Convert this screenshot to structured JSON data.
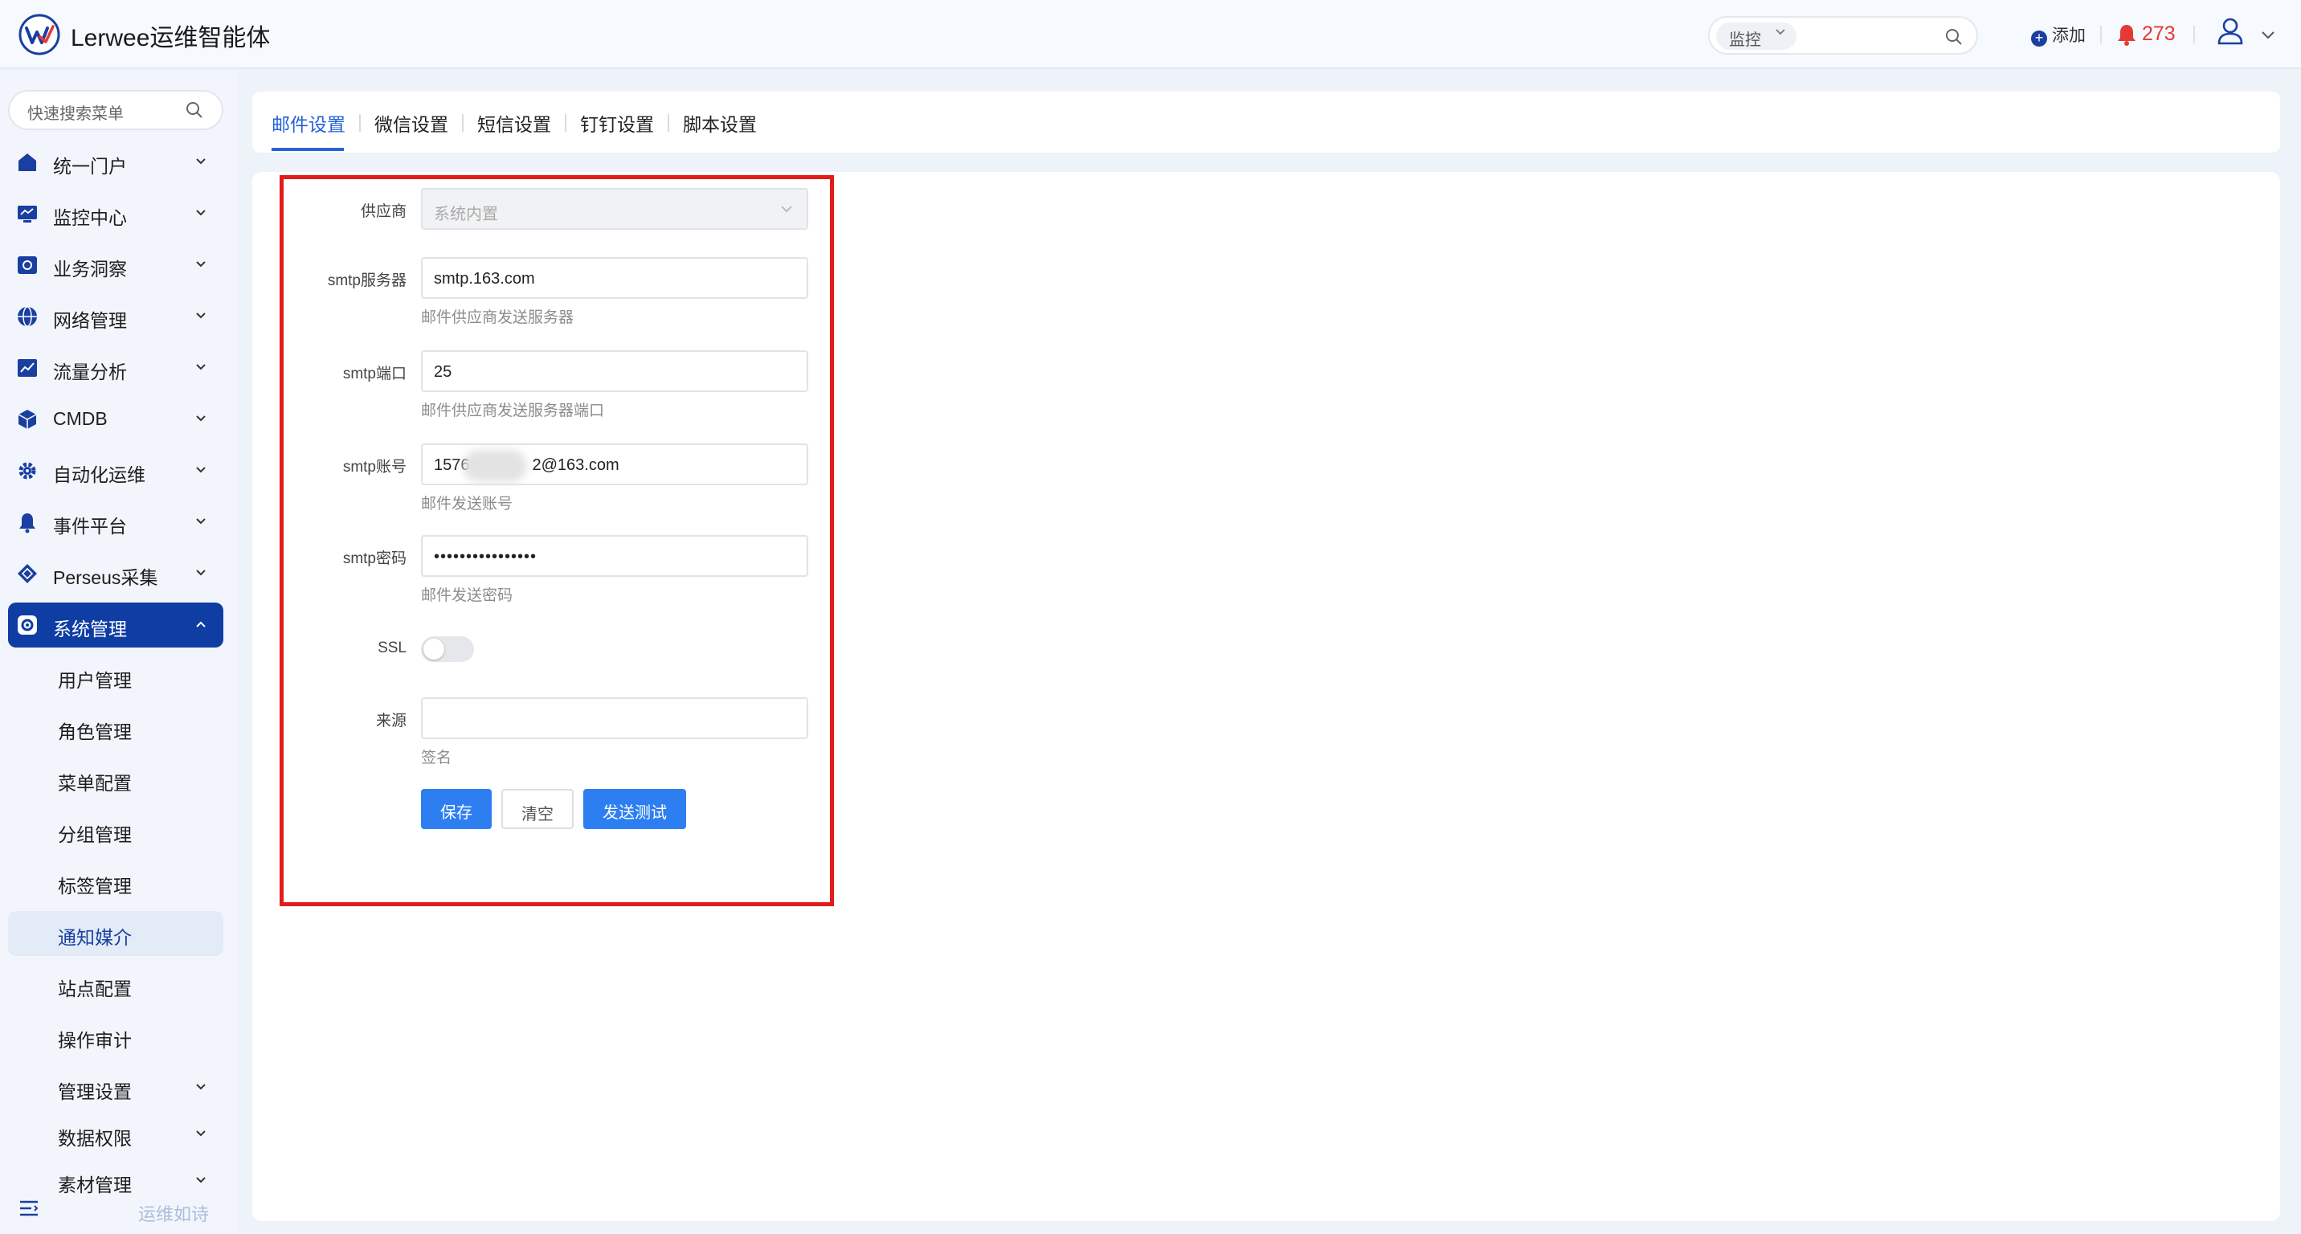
{
  "app": {
    "title": "Lerwee运维智能体"
  },
  "topbar": {
    "search_scope": "监控",
    "add_label": "添加",
    "alert_count": "273"
  },
  "sidebar": {
    "search_placeholder": "快速搜索菜单",
    "items": [
      {
        "label": "统一门户",
        "icon": "home-icon"
      },
      {
        "label": "监控中心",
        "icon": "monitor-icon"
      },
      {
        "label": "业务洞察",
        "icon": "insight-icon"
      },
      {
        "label": "网络管理",
        "icon": "globe-icon"
      },
      {
        "label": "流量分析",
        "icon": "chart-icon"
      },
      {
        "label": "CMDB",
        "icon": "cube-icon"
      },
      {
        "label": "自动化运维",
        "icon": "gear-icon"
      },
      {
        "label": "事件平台",
        "icon": "bell-icon"
      },
      {
        "label": "Perseus采集",
        "icon": "diamond-icon"
      },
      {
        "label": "系统管理",
        "icon": "settings-icon",
        "expanded": true
      }
    ],
    "sub_items": [
      {
        "label": "用户管理"
      },
      {
        "label": "角色管理"
      },
      {
        "label": "菜单配置"
      },
      {
        "label": "分组管理"
      },
      {
        "label": "标签管理"
      },
      {
        "label": "通知媒介",
        "current": true
      },
      {
        "label": "站点配置"
      },
      {
        "label": "操作审计"
      },
      {
        "label": "管理设置",
        "expandable": true
      },
      {
        "label": "数据权限",
        "expandable": true
      },
      {
        "label": "素材管理",
        "expandable": true
      }
    ],
    "footer_text": "运维如诗"
  },
  "tabs": [
    {
      "label": "邮件设置",
      "active": true
    },
    {
      "label": "微信设置"
    },
    {
      "label": "短信设置"
    },
    {
      "label": "钉钉设置"
    },
    {
      "label": "脚本设置"
    }
  ],
  "form": {
    "provider": {
      "label": "供应商",
      "value": "系统内置"
    },
    "smtp_server": {
      "label": "smtp服务器",
      "value": "smtp.163.com",
      "hint": "邮件供应商发送服务器"
    },
    "smtp_port": {
      "label": "smtp端口",
      "value": "25",
      "hint": "邮件供应商发送服务器端口"
    },
    "smtp_account": {
      "label": "smtp账号",
      "value_prefix": "1576",
      "value_suffix": "2@163.com",
      "hint": "邮件发送账号"
    },
    "smtp_password": {
      "label": "smtp密码",
      "value": "••••••••••••••••",
      "hint": "邮件发送密码"
    },
    "ssl": {
      "label": "SSL",
      "enabled": false
    },
    "source": {
      "label": "来源",
      "value": "",
      "hint": "签名"
    },
    "buttons": {
      "save": "保存",
      "clear": "清空",
      "send_test": "发送测试"
    }
  },
  "colors": {
    "accent": "#2563d8",
    "sidebar_active": "#0e3da3",
    "primary_button": "#2d7ff1",
    "alert": "#e53935",
    "highlight_border": "#e11c1c"
  }
}
